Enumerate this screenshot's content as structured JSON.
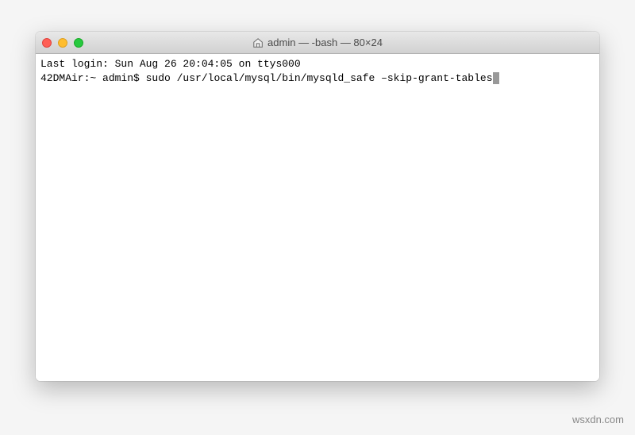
{
  "window": {
    "title": "admin — -bash — 80×24"
  },
  "terminal": {
    "line1": "Last login: Sun Aug 26 20:04:05 on ttys000",
    "prompt": "42DMAir:~ admin$ ",
    "command": "sudo /usr/local/mysql/bin/mysqld_safe –skip-grant-tables"
  },
  "watermark": "wsxdn.com"
}
